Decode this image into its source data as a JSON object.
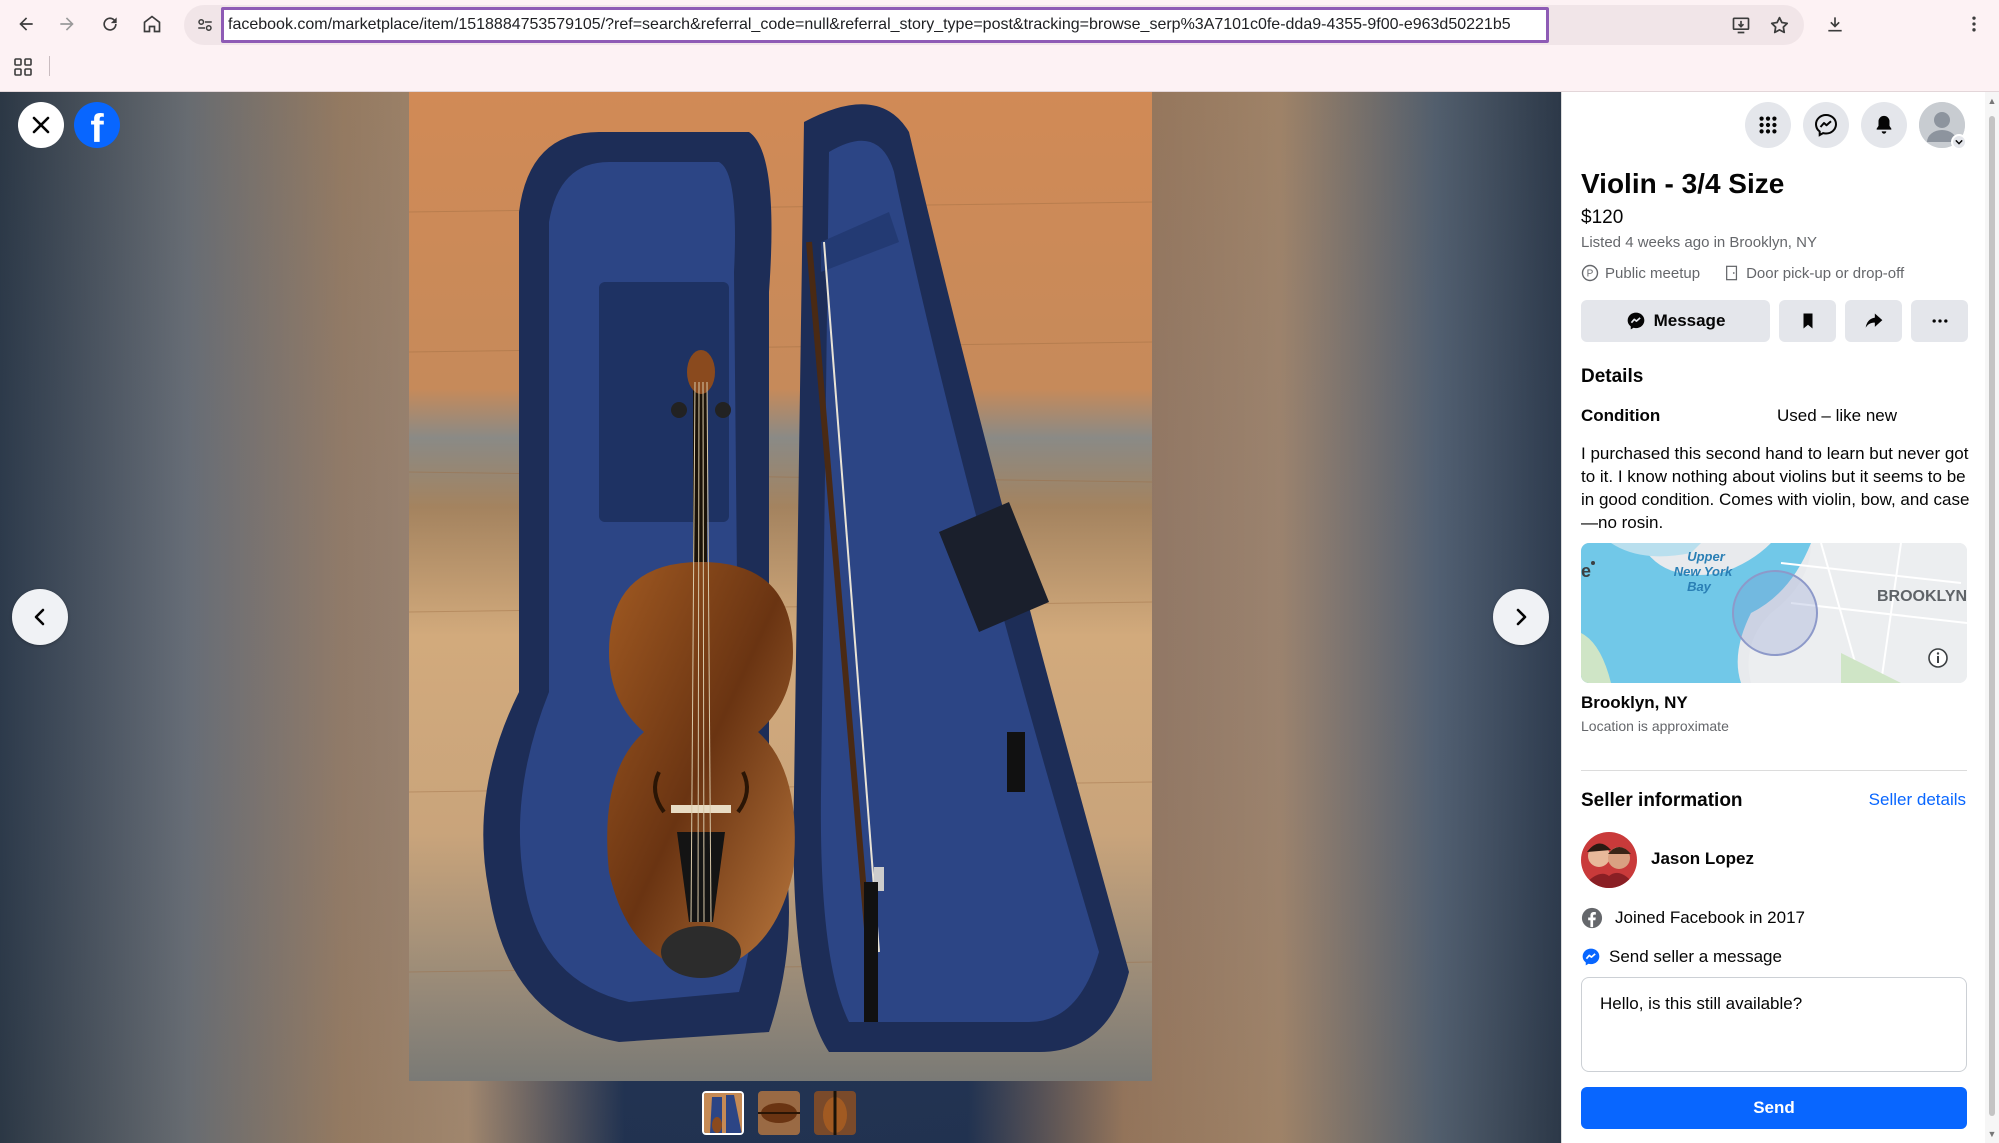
{
  "browser": {
    "url": "facebook.com/marketplace/item/1518884753579105/?ref=search&referral_code=null&referral_story_type=post&tracking=browse_serp%3A7101c0fe-dda9-4355-9f00-e963d50221b5"
  },
  "viewer": {
    "photo_count": 3,
    "selected_photo": 1,
    "fb_letter": "f"
  },
  "listing": {
    "title": "Violin - 3/4 Size",
    "price": "$120",
    "listed": "Listed 4 weeks ago in Brooklyn, NY",
    "meetup_options": [
      "Public meetup",
      "Door pick-up or drop-off"
    ]
  },
  "actions": {
    "message_label": "Message"
  },
  "details": {
    "heading": "Details",
    "condition_label": "Condition",
    "condition_value": "Used – like new",
    "description": "I purchased this second hand to learn but never got to it. I know nothing about violins but it seems to be in good condition. Comes with violin, bow, and case—no rosin."
  },
  "map": {
    "labels": [
      "Upper",
      "New York",
      "Bay",
      "BROOKLYN",
      "e"
    ],
    "location_name": "Brooklyn, NY",
    "location_note": "Location is approximate"
  },
  "seller": {
    "heading": "Seller information",
    "details_link": "Seller details",
    "name": "Jason Lopez",
    "joined": "Joined Facebook in 2017"
  },
  "message": {
    "label": "Send seller a message",
    "value": "Hello, is this still available?",
    "send_label": "Send"
  },
  "colors": {
    "brand_blue": "#0866ff",
    "url_highlight": "#8e5bb5"
  }
}
